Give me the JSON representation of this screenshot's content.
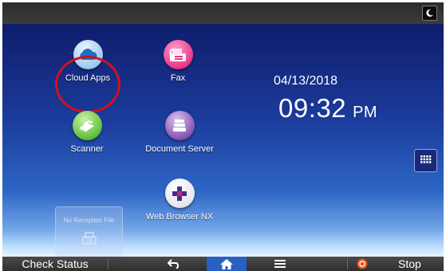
{
  "apps": {
    "cloud_apps": "Cloud Apps",
    "fax": "Fax",
    "scanner": "Scanner",
    "document_server": "Document Server",
    "web_browser": "Web Browser NX"
  },
  "clock": {
    "date": "04/13/2018",
    "time": "09:32",
    "ampm": "PM"
  },
  "fax_widget": {
    "label": "No Reception File"
  },
  "bottom_bar": {
    "check_status": "Check Status",
    "stop": "Stop"
  },
  "icons": {
    "energy_saver": "moon-icon",
    "app_list": "grid-icon",
    "back": "back-arrow-icon",
    "home": "home-icon",
    "menu": "menu-icon",
    "stop": "stop-icon"
  },
  "colors": {
    "highlight_ring": "#d2101e",
    "home_button": "#2a5fc4",
    "stop_icon": "#e8551e"
  }
}
